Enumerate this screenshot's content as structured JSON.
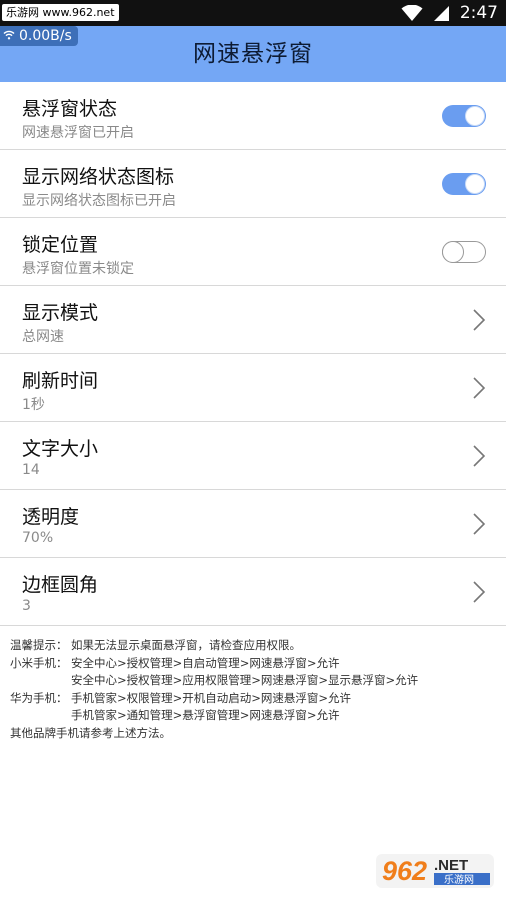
{
  "status_bar": {
    "watermark": "乐游网 www.962.net",
    "time": "2:47"
  },
  "speed_float": {
    "text": "0.00B/s"
  },
  "header": {
    "title": "网速悬浮窗"
  },
  "settings": [
    {
      "title": "悬浮窗状态",
      "subtitle": "网速悬浮窗已开启",
      "control": "switch",
      "on": true
    },
    {
      "title": "显示网络状态图标",
      "subtitle": "显示网络状态图标已开启",
      "control": "switch",
      "on": true
    },
    {
      "title": "锁定位置",
      "subtitle": "悬浮窗位置未锁定",
      "control": "switch",
      "on": false
    },
    {
      "title": "显示模式",
      "subtitle": "总网速",
      "control": "chevron"
    },
    {
      "title": "刷新时间",
      "subtitle": "1秒",
      "control": "chevron"
    },
    {
      "title": "文字大小",
      "subtitle": "14",
      "control": "chevron"
    },
    {
      "title": "透明度",
      "subtitle": "70%",
      "control": "chevron"
    },
    {
      "title": "边框圆角",
      "subtitle": "3",
      "control": "chevron"
    }
  ],
  "tips": {
    "line1_label": "温馨提示：",
    "line1_text": "如果无法显示桌面悬浮窗，请检查应用权限。",
    "line2_label": "小米手机：",
    "line2_text": "安全中心>授权管理>自启动管理>网速悬浮窗>允许",
    "line3_text": "安全中心>授权管理>应用权限管理>网速悬浮窗>显示悬浮窗>允许",
    "line4_label": "华为手机：",
    "line4_text": "手机管家>权限管理>开机自动启动>网速悬浮窗>允许",
    "line5_text": "手机管家>通知管理>悬浮窗管理>网速悬浮窗>允许",
    "line6_text": "其他品牌手机请参考上述方法。"
  },
  "watermark_bottom": {
    "number": "962",
    "domain": ".NET",
    "brand": "乐游网"
  },
  "colors": {
    "header": "#74a7f5",
    "switch_on": "#6a9df0",
    "status_bar": "#111111"
  }
}
